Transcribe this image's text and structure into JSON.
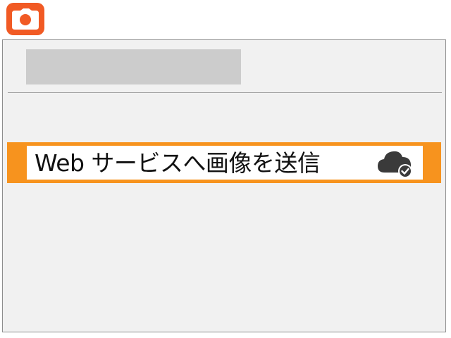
{
  "header": {
    "mode_icon": "camera-icon",
    "mode_color": "#f15a24"
  },
  "menu": {
    "accent_color": "#f7931e",
    "items": [
      {
        "label": "Web サービスへ画像を送信",
        "icon": "cloud-check-icon",
        "selected": true
      }
    ]
  }
}
